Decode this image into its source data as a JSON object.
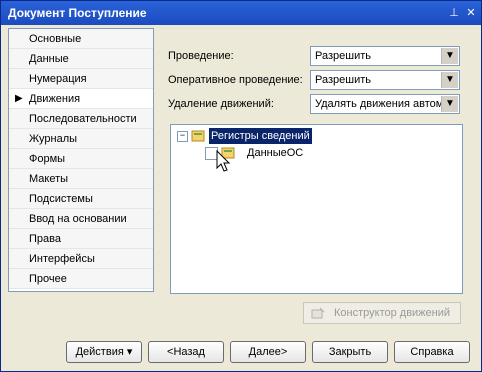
{
  "window": {
    "title": "Документ Поступление",
    "titlebar_controls": [
      "pin-icon",
      "close-icon"
    ]
  },
  "sidebar": {
    "items": [
      {
        "label": "Основные",
        "active": false
      },
      {
        "label": "Данные",
        "active": false
      },
      {
        "label": "Нумерация",
        "active": false
      },
      {
        "label": "Движения",
        "active": true
      },
      {
        "label": "Последовательности",
        "active": false
      },
      {
        "label": "Журналы",
        "active": false
      },
      {
        "label": "Формы",
        "active": false
      },
      {
        "label": "Макеты",
        "active": false
      },
      {
        "label": "Подсистемы",
        "active": false
      },
      {
        "label": "Ввод на основании",
        "active": false
      },
      {
        "label": "Права",
        "active": false
      },
      {
        "label": "Интерфейсы",
        "active": false
      },
      {
        "label": "Прочее",
        "active": false
      }
    ]
  },
  "fields": {
    "posting_label": "Проведение:",
    "posting_value": "Разрешить",
    "operative_label": "Оперативное проведение:",
    "operative_value": "Разрешить",
    "delete_label": "Удаление движений:",
    "delete_value": "Удалять движения автом"
  },
  "tree": {
    "root_label": "Регистры сведений",
    "child_label": "ДанныеОС"
  },
  "buttons": {
    "constructor": "Конструктор движений",
    "actions": "Действия",
    "back": "<Назад",
    "next": "Далее>",
    "close": "Закрыть",
    "help": "Справка"
  },
  "colors": {
    "titlebar": "#1c4bbf",
    "selection": "#0a246a"
  }
}
